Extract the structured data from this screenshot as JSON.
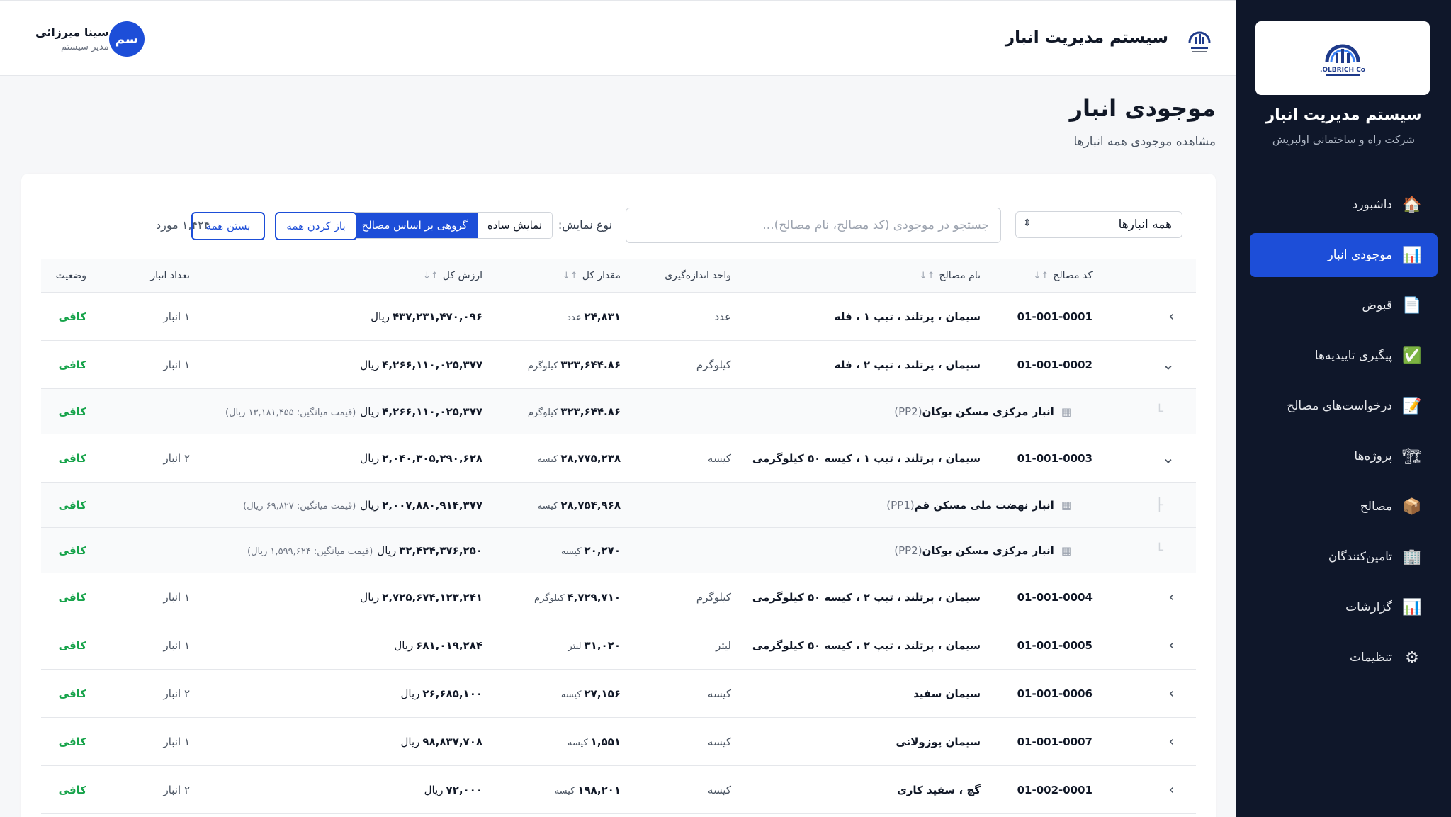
{
  "sidebar": {
    "title": "سیستم مدیریت انبار",
    "subtitle": "شرکت راه و ساختمانی اولبریش",
    "logo_text": "OLBRICH Co.",
    "items": [
      {
        "label": "داشبورد",
        "icon": "🏠",
        "icon_name": "home-icon",
        "active": false
      },
      {
        "label": "موجودی انبار",
        "icon": "📊",
        "icon_name": "chart-icon",
        "active": true
      },
      {
        "label": "قبوض",
        "icon": "📄",
        "icon_name": "document-icon",
        "active": false
      },
      {
        "label": "پیگیری تاییدیه‌ها",
        "icon": "✅",
        "icon_name": "check-icon",
        "active": false
      },
      {
        "label": "درخواست‌های مصالح",
        "icon": "📝",
        "icon_name": "memo-icon",
        "active": false
      },
      {
        "label": "پروژه‌ها",
        "icon": "🏗",
        "icon_name": "crane-icon",
        "active": false
      },
      {
        "label": "مصالح",
        "icon": "📦",
        "icon_name": "package-icon",
        "active": false
      },
      {
        "label": "تامین‌کنندگان",
        "icon": "🏢",
        "icon_name": "building-icon",
        "active": false
      },
      {
        "label": "گزارشات",
        "icon": "📊",
        "icon_name": "report-icon",
        "active": false
      },
      {
        "label": "تنظیمات",
        "icon": "⚙",
        "icon_name": "gear-icon",
        "active": false
      }
    ]
  },
  "header": {
    "title": "سیستم مدیریت انبار",
    "user_name": "سینا میرزائی",
    "user_role": "مدیر سیستم",
    "avatar_initials": "سم"
  },
  "page": {
    "title": "موجودی انبار",
    "subtitle": "مشاهده موجودی همه انبارها"
  },
  "filters": {
    "warehouse_select": "همه انبارها",
    "search_placeholder": "جستجو در موجودی (کد مصالح، نام مصالح)...",
    "view_label": "نوع نمایش:",
    "view_simple": "نمایش ساده",
    "view_grouped": "گروهی بر اساس مصالح",
    "expand_all": "باز کردن همه",
    "collapse_all": "بستن همه",
    "count": "۱,۴۲۴ مورد"
  },
  "table": {
    "headers": {
      "code": "کد مصالح",
      "name": "نام مصالح",
      "unit": "واحد اندازه‌گیری",
      "qty": "مقدار کل",
      "value": "ارزش کل",
      "warehouses": "تعداد انبار",
      "status": "وضعیت"
    },
    "rows": [
      {
        "type": "main",
        "expanded": false,
        "code": "01-001-0001",
        "name": "سیمان ، پرتلند ، تیپ ۱ ، فله",
        "unit": "عدد",
        "qty": "۲۴,۸۳۱",
        "qty_unit": "عدد",
        "value": "۴۳۷,۲۳۱,۴۷۰,۰۹۶",
        "currency": "ریال",
        "warehouses": "۱ انبار",
        "status": "کافی"
      },
      {
        "type": "main",
        "expanded": true,
        "code": "01-001-0002",
        "name": "سیمان ، پرتلند ، تیپ ۲ ، فله",
        "unit": "کیلوگرم",
        "qty": "۳۲۳,۶۴۴.۸۶",
        "qty_unit": "کیلوگرم",
        "value": "۴,۲۶۶,۱۱۰,۰۲۵,۳۷۷",
        "currency": "ریال",
        "warehouses": "۱ انبار",
        "status": "کافی"
      },
      {
        "type": "sub",
        "tree": "└",
        "wh_name": "انبار مرکزی مسکن بوکان",
        "wh_code": "(PP2)",
        "qty": "۳۲۳,۶۴۴.۸۶",
        "qty_unit": "کیلوگرم",
        "value": "۴,۲۶۶,۱۱۰,۰۲۵,۳۷۷",
        "currency": "ریال",
        "avg": "(قیمت میانگین: ۱۳,۱۸۱,۴۵۵ ریال)",
        "status": "کافی"
      },
      {
        "type": "main",
        "expanded": true,
        "code": "01-001-0003",
        "name": "سیمان ، پرتلند ، تیپ ۱ ، کیسه ۵۰ کیلوگرمی",
        "unit": "کیسه",
        "qty": "۲۸,۷۷۵,۲۳۸",
        "qty_unit": "کیسه",
        "value": "۲,۰۴۰,۳۰۵,۲۹۰,۶۲۸",
        "currency": "ریال",
        "warehouses": "۲ انبار",
        "status": "کافی"
      },
      {
        "type": "sub",
        "tree": "├",
        "wh_name": "انبار نهضت ملی مسکن قم",
        "wh_code": "(PP1)",
        "qty": "۲۸,۷۵۴,۹۶۸",
        "qty_unit": "کیسه",
        "value": "۲,۰۰۷,۸۸۰,۹۱۴,۳۷۷",
        "currency": "ریال",
        "avg": "(قیمت میانگین: ۶۹,۸۲۷ ریال)",
        "status": "کافی"
      },
      {
        "type": "sub",
        "tree": "└",
        "wh_name": "انبار مرکزی مسکن بوکان",
        "wh_code": "(PP2)",
        "qty": "۲۰,۲۷۰",
        "qty_unit": "کیسه",
        "value": "۳۲,۴۲۴,۳۷۶,۲۵۰",
        "currency": "ریال",
        "avg": "(قیمت میانگین: ۱,۵۹۹,۶۲۴ ریال)",
        "status": "کافی"
      },
      {
        "type": "main",
        "expanded": false,
        "code": "01-001-0004",
        "name": "سیمان ، پرتلند ، تیپ ۲ ، کیسه ۵۰ کیلوگرمی",
        "unit": "کیلوگرم",
        "qty": "۴,۷۲۹,۷۱۰",
        "qty_unit": "کیلوگرم",
        "value": "۲,۷۲۵,۶۷۴,۱۲۳,۲۴۱",
        "currency": "ریال",
        "warehouses": "۱ انبار",
        "status": "کافی"
      },
      {
        "type": "main",
        "expanded": false,
        "code": "01-001-0005",
        "name": "سیمان ، پرتلند ، تیپ ۲ ، کیسه ۵۰ کیلوگرمی",
        "unit": "لیتر",
        "qty": "۳۱,۰۲۰",
        "qty_unit": "لیتر",
        "value": "۶۸۱,۰۱۹,۲۸۴",
        "currency": "ریال",
        "warehouses": "۱ انبار",
        "status": "کافی"
      },
      {
        "type": "main",
        "expanded": false,
        "code": "01-001-0006",
        "name": "سیمان سفید",
        "unit": "کیسه",
        "qty": "۲۷,۱۵۶",
        "qty_unit": "کیسه",
        "value": "۲۶,۶۸۵,۱۰۰",
        "currency": "ریال",
        "warehouses": "۲ انبار",
        "status": "کافی"
      },
      {
        "type": "main",
        "expanded": false,
        "code": "01-001-0007",
        "name": "سیمان پوزولانی",
        "unit": "کیسه",
        "qty": "۱,۵۵۱",
        "qty_unit": "کیسه",
        "value": "۹۸,۸۳۷,۷۰۸",
        "currency": "ریال",
        "warehouses": "۱ انبار",
        "status": "کافی"
      },
      {
        "type": "main",
        "expanded": false,
        "code": "01-002-0001",
        "name": "گچ ، سفید کاری",
        "unit": "کیسه",
        "qty": "۱۹۸,۲۰۱",
        "qty_unit": "کیسه",
        "value": "۷۲,۰۰۰",
        "currency": "ریال",
        "warehouses": "۲ انبار",
        "status": "کافی"
      }
    ]
  },
  "colors": {
    "primary": "#1d4ed8",
    "sidebar_bg": "#0f172a",
    "status_ok": "#16a34a"
  }
}
